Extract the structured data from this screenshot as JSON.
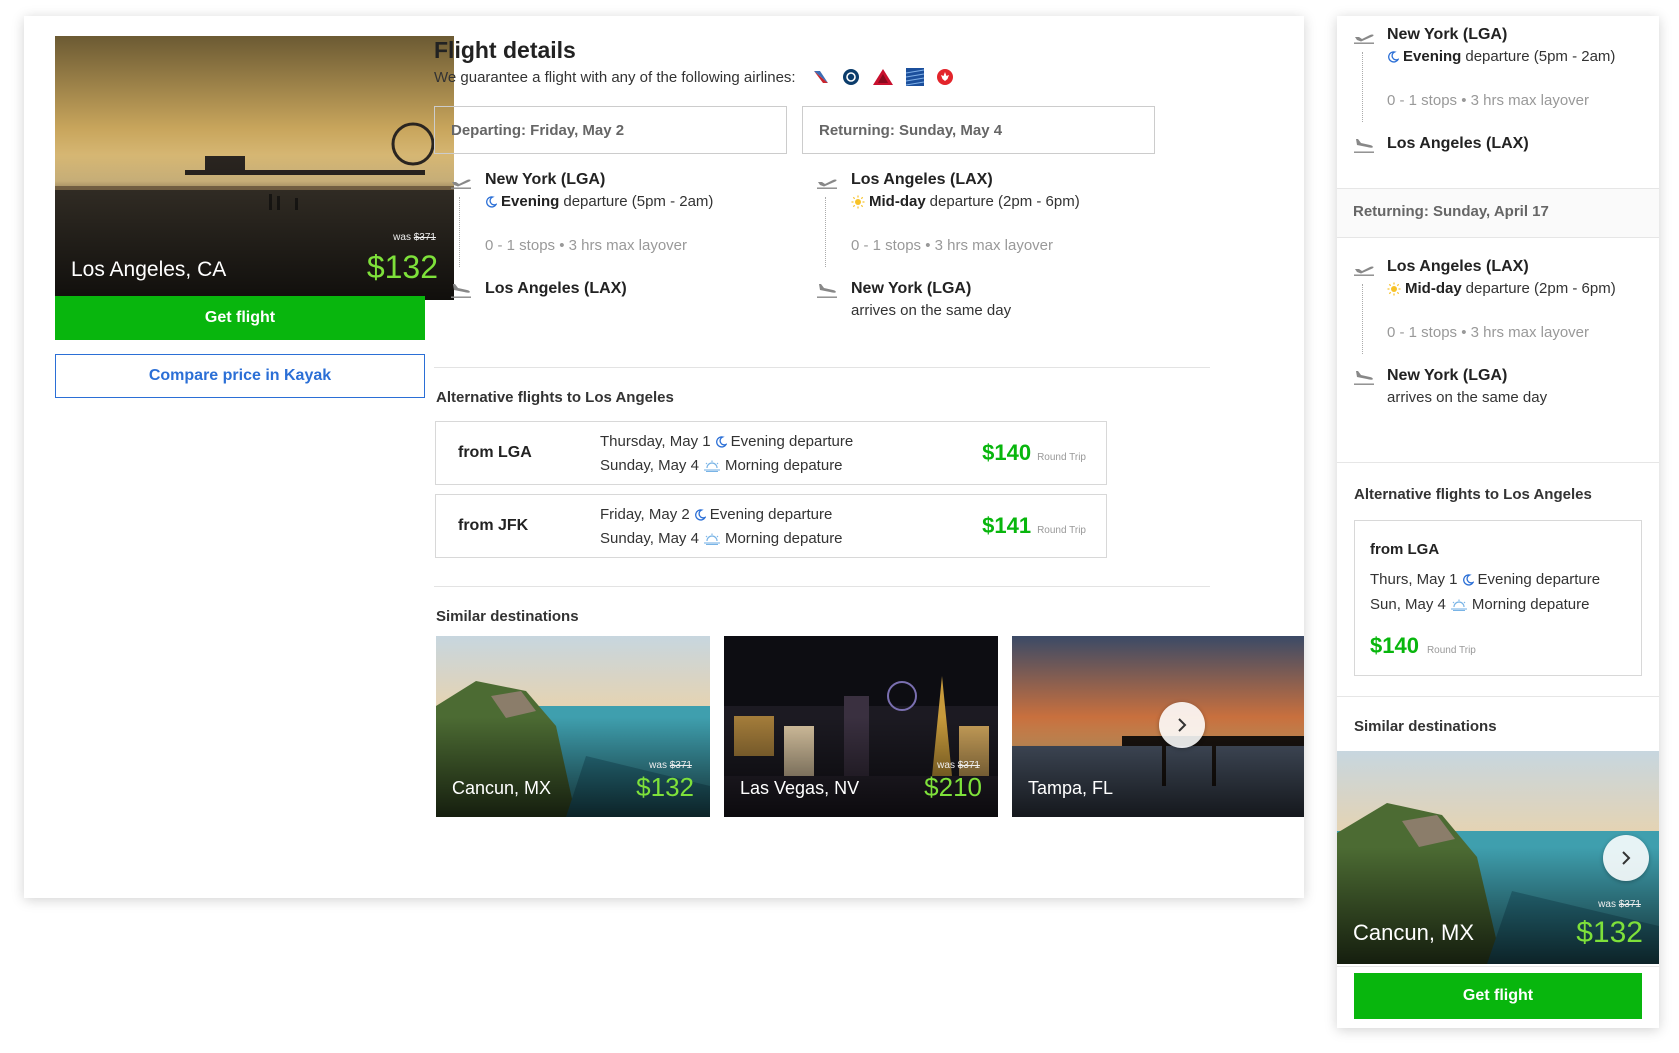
{
  "hero": {
    "city": "Los Angeles, CA",
    "was_label": "was",
    "was_price": "$371",
    "price": "$132"
  },
  "buttons": {
    "get_flight": "Get flight",
    "compare_kayak": "Compare price in Kayak"
  },
  "details": {
    "title": "Flight details",
    "guarantee": "We guarantee a flight with any of the following airlines:",
    "airlines": [
      "american-airlines-icon",
      "alaska-airlines-icon",
      "delta-icon",
      "united-icon",
      "air-canada-icon"
    ]
  },
  "departing": {
    "label": "Departing: Friday, May 2",
    "from": "New York (LGA)",
    "time_bold": "Evening",
    "time_rest": "departure (5pm - 2am)",
    "stops": "0 - 1 stops • 3 hrs max layover",
    "to": "Los Angeles (LAX)"
  },
  "returning": {
    "label": "Returning: Sunday, May 4",
    "from": "Los Angeles (LAX)",
    "time_bold": "Mid-day",
    "time_rest": "departure (2pm - 6pm)",
    "stops": "0 - 1 stops • 3 hrs max layover",
    "to": "New York (LGA)",
    "arrives": "arrives on the same day"
  },
  "alternatives": {
    "title": "Alternative flights to Los Angeles",
    "rows": [
      {
        "from": "from LGA",
        "line1_date": "Thursday, May 1",
        "line1_time": "Evening departure",
        "line2_date": "Sunday, May 4",
        "line2_time": "Morning depature",
        "price": "$140",
        "price_note": "Round Trip"
      },
      {
        "from": "from JFK",
        "line1_date": "Friday, May 2",
        "line1_time": "Evening departure",
        "line2_date": "Sunday, May 4",
        "line2_time": "Morning depature",
        "price": "$141",
        "price_note": "Round Trip"
      }
    ]
  },
  "similar": {
    "title": "Similar destinations",
    "cards": [
      {
        "city": "Cancun, MX",
        "was_label": "was",
        "was_price": "$371",
        "price": "$132"
      },
      {
        "city": "Las Vegas, NV",
        "was_label": "was",
        "was_price": "$371",
        "price": "$210"
      },
      {
        "city": "Tampa, FL",
        "was_label": "",
        "was_price": "",
        "price": ""
      }
    ]
  },
  "side": {
    "departing": {
      "from": "New York (LGA)",
      "time_bold": "Evening",
      "time_rest": "departure (5pm - 2am)",
      "stops": "0 - 1 stops • 3 hrs max layover",
      "to": "Los Angeles (LAX)"
    },
    "returning_label": "Returning: Sunday, April 17",
    "returning": {
      "from": "Los Angeles (LAX)",
      "time_bold": "Mid-day",
      "time_rest": "departure (2pm - 6pm)",
      "stops": "0 - 1 stops • 3 hrs max layover",
      "to": "New York (LGA)",
      "arrives": "arrives on the same day"
    },
    "alt_title": "Alternative flights to Los Angeles",
    "alt": {
      "from": "from LGA",
      "line1_date": "Thurs, May 1",
      "line1_time": "Evening departure",
      "line2_date": "Sun, May 4",
      "line2_time": "Morning depature",
      "price": "$140",
      "price_note": "Round Trip"
    },
    "similar_title": "Similar destinations",
    "card": {
      "city": "Cancun, MX",
      "was_label": "was",
      "was_price": "$371",
      "price": "$132"
    },
    "get_flight": "Get flight"
  },
  "colors": {
    "green": "#08b60d",
    "price_light_green": "#7ee13a",
    "link_blue": "#2b6fd6"
  }
}
